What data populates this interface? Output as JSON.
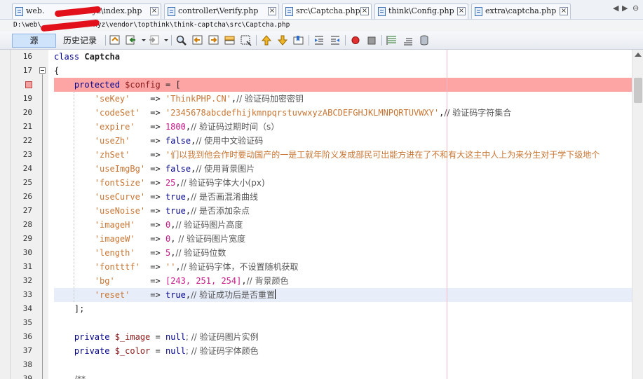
{
  "tabs": [
    {
      "label": "web.",
      "suffix": "xyz\\index.php",
      "active": false
    },
    {
      "label": "controller\\Verify.php",
      "active": false
    },
    {
      "label": "src\\Captcha.php",
      "active": true
    },
    {
      "label": "think\\Config.php",
      "active": false
    },
    {
      "label": "extra\\captcha.php",
      "active": false
    }
  ],
  "tab_nav": {
    "prev": "◀",
    "next": "▶",
    "menu": "⊖"
  },
  "path": {
    "prefix": "D:\\web\\",
    "suffix": "xyz\\vendor\\topthink\\think-captcha\\src\\Captcha.php"
  },
  "toolbar": {
    "source_label": "源",
    "history_label": "历史记录"
  },
  "colors": {
    "breakpoint_line": "#fda4a4",
    "current_line": "#e8eef9",
    "keyword": "#00008b",
    "string": "#c87533",
    "number": "#c71585",
    "variable": "#8b1a1a"
  },
  "editor": {
    "line_numbers": [
      "16",
      "17",
      "",
      "19",
      "20",
      "21",
      "22",
      "23",
      "24",
      "25",
      "26",
      "27",
      "28",
      "29",
      "30",
      "31",
      "32",
      "33",
      "34",
      "35",
      "36",
      "37",
      "38",
      "39"
    ],
    "code": {
      "l16_kw": "class ",
      "l16_name": "Captcha",
      "l17": "{",
      "l18_kw": "protected ",
      "l18_var": "$config",
      "l18_rest": " = [",
      "entries": [
        {
          "key": "'seKey'",
          "pad": "   ",
          "val": "'ThinkPHP.CN'",
          "vtype": "str",
          "comment": "// 验证码加密密钥"
        },
        {
          "key": "'codeSet'",
          "pad": " ",
          "val": "'2345678abcdefhijkmnpqrstuvwxyzABCDEFGHJKLMNPQRTUVWXY'",
          "vtype": "str",
          "comment": "// 验证码字符集合"
        },
        {
          "key": "'expire'",
          "pad": "  ",
          "val": "1800",
          "vtype": "num",
          "comment": "// 验证码过期时间（s）"
        },
        {
          "key": "'useZh'",
          "pad": "   ",
          "val": "false",
          "vtype": "kw",
          "comment": "// 使用中文验证码"
        },
        {
          "key": "'zhSet'",
          "pad": "   ",
          "val": "'们以我到他会作时要动国产的一是工就年阶义发成部民可出能方进在了不和有大这主中人上为来分生对于学下级地个",
          "vtype": "str",
          "comment": ""
        },
        {
          "key": "'useImgBg'",
          "pad": "",
          "val": "false",
          "vtype": "kw",
          "comment": "// 使用背景图片"
        },
        {
          "key": "'fontSize'",
          "pad": "",
          "val": "25",
          "vtype": "num",
          "comment": "// 验证码字体大小(px)"
        },
        {
          "key": "'useCurve'",
          "pad": "",
          "val": "true",
          "vtype": "kw",
          "comment": "// 是否画混淆曲线"
        },
        {
          "key": "'useNoise'",
          "pad": "",
          "val": "true",
          "vtype": "kw",
          "comment": "// 是否添加杂点"
        },
        {
          "key": "'imageH'",
          "pad": "  ",
          "val": "0",
          "vtype": "num",
          "comment": "// 验证码图片高度"
        },
        {
          "key": "'imageW'",
          "pad": "  ",
          "val": "0",
          "vtype": "num",
          "comment": " // 验证码图片宽度"
        },
        {
          "key": "'length'",
          "pad": "  ",
          "val": "5",
          "vtype": "num",
          "comment": "// 验证码位数"
        },
        {
          "key": "'fontttf'",
          "pad": " ",
          "val": "''",
          "vtype": "str",
          "comment": "// 验证码字体，不设置随机获取"
        },
        {
          "key": "'bg'",
          "pad": "      ",
          "val": "[243, 251, 254]",
          "vtype": "arr",
          "comment": "// 背景颜色"
        },
        {
          "key": "'reset'",
          "pad": "   ",
          "val": "true",
          "vtype": "kw",
          "comment": "// 验证成功后是否重置"
        }
      ],
      "l34": "];",
      "l36_kw": "private ",
      "l36_var": "$_image",
      "l36_mid": " = ",
      "l36_null": "null",
      "l36_cm": "; // 验证码图片实例",
      "l37_kw": "private ",
      "l37_var": "$_color",
      "l37_mid": " = ",
      "l37_null": "null",
      "l37_cm": "; // 验证码字体颜色",
      "l39": "/**"
    }
  }
}
